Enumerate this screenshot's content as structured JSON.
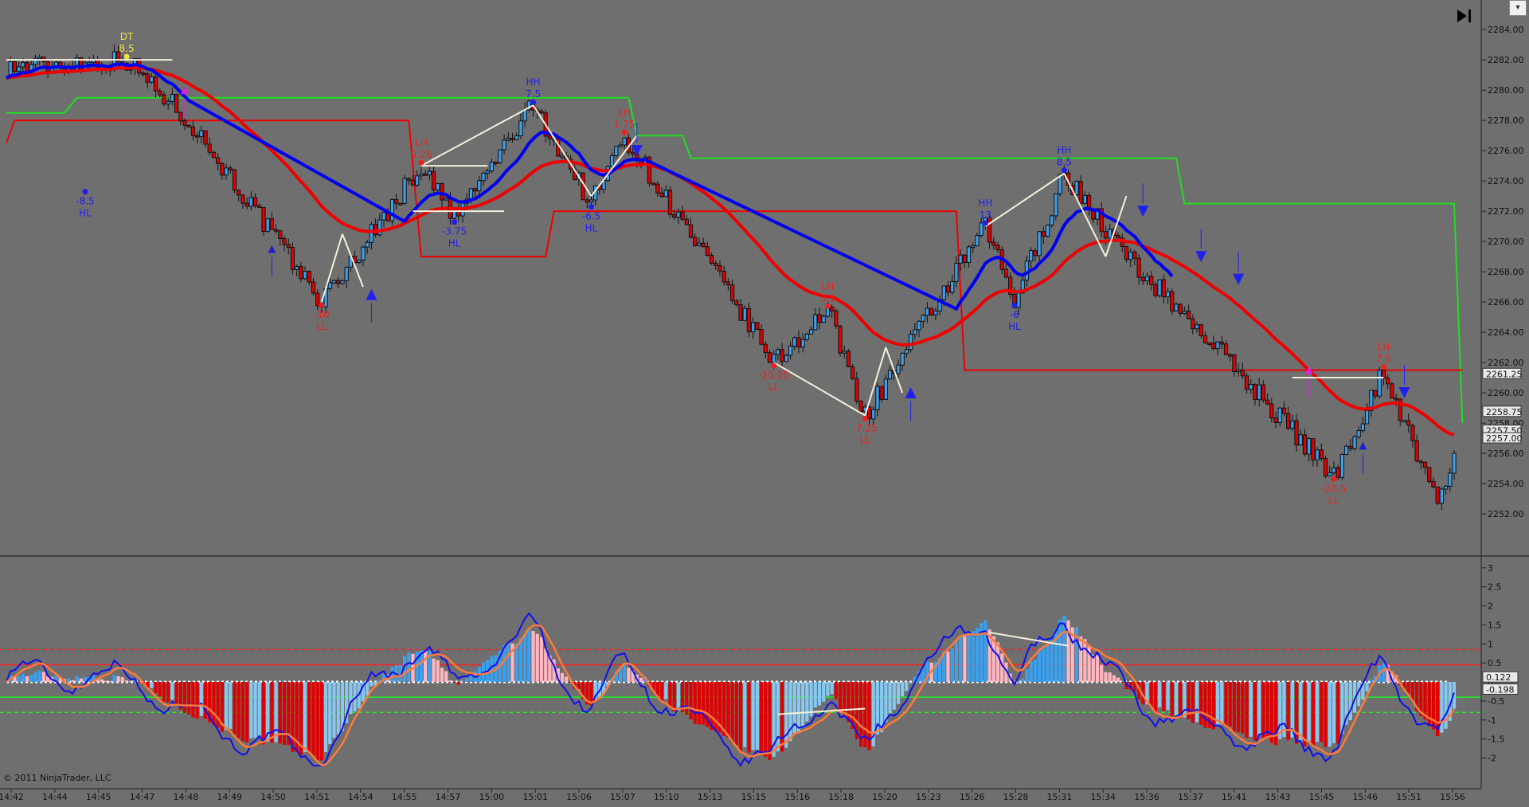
{
  "copyright": "© 2011 NinjaTrader, LLC",
  "scroll_button": "▾",
  "icons": {
    "skip_to_end": "skip-to-end-icon",
    "dropdown": "chevron-down-icon"
  },
  "colors": {
    "background": "#6f6f6f",
    "up_bar": "#3aa0f0",
    "down_bar": "#e00000",
    "ema_fast": "#0000ee",
    "ema_slow": "#ee0000",
    "upper_band": "#22dd22",
    "lower_band": "#ee0000",
    "swing_line": "#f5f0dc",
    "hist_pos_strong": "#3aa0f0",
    "hist_pos_weak": "#ffb6c1",
    "hist_neg_strong": "#e00000",
    "hist_neg_weak": "#87c8f0"
  },
  "chart_data": [
    {
      "type": "candlestick",
      "panel": "price",
      "y_ticks": [
        "2284.00",
        "2282.00",
        "2280.00",
        "2278.00",
        "2276.00",
        "2274.00",
        "2272.00",
        "2270.00",
        "2268.00",
        "2266.00",
        "2264.00",
        "2262.00",
        "2260.00",
        "2258.00",
        "2256.00",
        "2254.00",
        "2252.00"
      ],
      "ylim": [
        2251.0,
        2284.8
      ],
      "price_markers": [
        {
          "label": "2261.25",
          "value": 2261.25,
          "color": "#e8e8e8"
        },
        {
          "label": "2258.75",
          "value": 2258.75,
          "color": "#e8e8e8"
        },
        {
          "label": "2257.50",
          "value": 2257.5,
          "color": "#e8e8e8"
        },
        {
          "label": "2257.00",
          "value": 2257.0,
          "color": "#e8e8e8"
        }
      ],
      "annotations": [
        {
          "lines": [
            "DT",
            "8.5"
          ],
          "bar": 29,
          "price": 2282.0,
          "pos": "above",
          "color": "#f0e040"
        },
        {
          "lines": [
            "-8.5",
            "HL"
          ],
          "bar": 19,
          "price": 2273.5,
          "pos": "below",
          "color": "#2020ee"
        },
        {
          "lines": [
            "-10",
            "LL"
          ],
          "bar": 76,
          "price": 2266.0,
          "pos": "below",
          "color": "#ee2020"
        },
        {
          "lines": [
            "LH",
            "9.25"
          ],
          "bar": 100,
          "price": 2275.0,
          "pos": "above",
          "color": "#ee2020"
        },
        {
          "lines": [
            "-3.75",
            "HL"
          ],
          "bar": 108,
          "price": 2271.5,
          "pos": "below",
          "color": "#2020ee"
        },
        {
          "lines": [
            "HH",
            "7.5"
          ],
          "bar": 127,
          "price": 2279.0,
          "pos": "above",
          "color": "#2020ee"
        },
        {
          "lines": [
            "-6.5",
            "HL"
          ],
          "bar": 141,
          "price": 2272.5,
          "pos": "below",
          "color": "#2020ee"
        },
        {
          "lines": [
            "LH",
            "1.75"
          ],
          "bar": 149,
          "price": 2277.0,
          "pos": "above",
          "color": "#ee2020"
        },
        {
          "lines": [
            "LH",
            "3.5"
          ],
          "bar": 198,
          "price": 2265.5,
          "pos": "above",
          "color": "#ee2020"
        },
        {
          "lines": [
            "-15.25",
            "LL"
          ],
          "bar": 185,
          "price": 2262.0,
          "pos": "below",
          "color": "#ee2020"
        },
        {
          "lines": [
            "-7.25",
            "LL"
          ],
          "bar": 207,
          "price": 2258.5,
          "pos": "below",
          "color": "#ee2020"
        },
        {
          "lines": [
            "HH",
            "13"
          ],
          "bar": 236,
          "price": 2271.0,
          "pos": "above",
          "color": "#2020ee"
        },
        {
          "lines": [
            "-6",
            "HL"
          ],
          "bar": 243,
          "price": 2266.0,
          "pos": "below",
          "color": "#2020ee"
        },
        {
          "lines": [
            "HH",
            "8.5"
          ],
          "bar": 255,
          "price": 2274.5,
          "pos": "above",
          "color": "#2020ee"
        },
        {
          "lines": [
            "-20.5",
            "LL"
          ],
          "bar": 320,
          "price": 2254.5,
          "pos": "below",
          "color": "#ee2020"
        },
        {
          "lines": [
            "LH",
            "7.5"
          ],
          "bar": 332,
          "price": 2261.5,
          "pos": "above",
          "color": "#ee2020"
        }
      ],
      "pivot_path": [
        {
          "bar": 0,
          "price": 2281.5
        },
        {
          "bar": 29,
          "price": 2282.0
        },
        {
          "bar": 44,
          "price": 2278.0
        },
        {
          "bar": 76,
          "price": 2266.0
        },
        {
          "bar": 100,
          "price": 2275.0
        },
        {
          "bar": 108,
          "price": 2271.5
        },
        {
          "bar": 127,
          "price": 2279.0
        },
        {
          "bar": 141,
          "price": 2272.5
        },
        {
          "bar": 149,
          "price": 2277.0
        },
        {
          "bar": 185,
          "price": 2262.0
        },
        {
          "bar": 198,
          "price": 2265.5
        },
        {
          "bar": 207,
          "price": 2258.5
        },
        {
          "bar": 236,
          "price": 2271.0
        },
        {
          "bar": 243,
          "price": 2266.0
        },
        {
          "bar": 255,
          "price": 2274.5
        },
        {
          "bar": 270,
          "price": 2269.0
        },
        {
          "bar": 290,
          "price": 2263.5
        },
        {
          "bar": 320,
          "price": 2254.5
        },
        {
          "bar": 332,
          "price": 2261.5
        },
        {
          "bar": 345,
          "price": 2252.5
        },
        {
          "bar": 349,
          "price": 2256.0
        }
      ],
      "swing_lines": [
        {
          "from": [
            0,
            2282.0
          ],
          "to": [
            40,
            2282.0
          ]
        },
        {
          "from": [
            100,
            2275.0
          ],
          "to": [
            127,
            2279.0
          ]
        },
        {
          "from": [
            100,
            2275.0
          ],
          "to": [
            116,
            2275.0
          ]
        },
        {
          "from": [
            98,
            2272.0
          ],
          "to": [
            120,
            2272.0
          ]
        },
        {
          "from": [
            127,
            2279.0
          ],
          "to": [
            141,
            2273.0
          ]
        },
        {
          "from": [
            141,
            2273.0
          ],
          "to": [
            152,
            2277.0
          ]
        },
        {
          "from": [
            76,
            2266.0
          ],
          "to": [
            81,
            2270.5
          ]
        },
        {
          "from": [
            81,
            2270.5
          ],
          "to": [
            86,
            2267.0
          ]
        },
        {
          "from": [
            185,
            2262.0
          ],
          "to": [
            207,
            2258.5
          ]
        },
        {
          "from": [
            207,
            2258.5
          ],
          "to": [
            212,
            2263.0
          ]
        },
        {
          "from": [
            212,
            2263.0
          ],
          "to": [
            216,
            2260.0
          ]
        },
        {
          "from": [
            236,
            2271.0
          ],
          "to": [
            255,
            2274.5
          ]
        },
        {
          "from": [
            255,
            2274.5
          ],
          "to": [
            265,
            2269.0
          ]
        },
        {
          "from": [
            265,
            2269.0
          ],
          "to": [
            270,
            2273.0
          ]
        },
        {
          "from": [
            310,
            2261.0
          ],
          "to": [
            332,
            2261.0
          ]
        }
      ],
      "arrows": [
        {
          "bar": 64,
          "price": 2269.5,
          "dir": "up",
          "color": "#2020cc",
          "small": true
        },
        {
          "bar": 88,
          "price": 2266.5,
          "dir": "up",
          "color": "#2020ee"
        },
        {
          "bar": 152,
          "price": 2276.0,
          "dir": "down",
          "color": "#2020ee"
        },
        {
          "bar": 43,
          "price": 2280.0,
          "dir": "up",
          "color": "#dd22dd",
          "small": true
        },
        {
          "bar": 218,
          "price": 2260.0,
          "dir": "up",
          "color": "#2020ee"
        },
        {
          "bar": 274,
          "price": 2272.0,
          "dir": "down",
          "color": "#2020ee"
        },
        {
          "bar": 288,
          "price": 2269.0,
          "dir": "down",
          "color": "#2020ee"
        },
        {
          "bar": 297,
          "price": 2267.5,
          "dir": "down",
          "color": "#2020ee"
        },
        {
          "bar": 314,
          "price": 2261.5,
          "dir": "up",
          "color": "#dd22dd",
          "small": true
        },
        {
          "bar": 327,
          "price": 2256.5,
          "dir": "up",
          "color": "#2020cc",
          "small": true
        },
        {
          "bar": 337,
          "price": 2260.0,
          "dir": "down",
          "color": "#2020ee"
        }
      ],
      "upper_band": [
        [
          0,
          2278.5
        ],
        [
          14,
          2278.5
        ],
        [
          17,
          2279.5
        ],
        [
          150,
          2279.5
        ],
        [
          152,
          2277.0
        ],
        [
          163,
          2277.0
        ],
        [
          165,
          2275.5
        ],
        [
          282,
          2275.5
        ],
        [
          284,
          2272.5
        ],
        [
          349,
          2272.5
        ],
        [
          351,
          2258.0
        ]
      ],
      "lower_band": [
        [
          0,
          2276.5
        ],
        [
          2,
          2278.0
        ],
        [
          97,
          2278.0
        ],
        [
          100,
          2269.0
        ],
        [
          130,
          2269.0
        ],
        [
          132,
          2272.0
        ],
        [
          229,
          2272.0
        ],
        [
          231,
          2261.5
        ],
        [
          351,
          2261.5
        ]
      ],
      "time_labels": [
        "14:42",
        "14:44",
        "14:45",
        "14:47",
        "14:48",
        "14:49",
        "14:50",
        "14:51",
        "14:54",
        "14:55",
        "14:57",
        "15:00",
        "15:01",
        "15:06",
        "15:07",
        "15:10",
        "15:13",
        "15:15",
        "15:16",
        "15:18",
        "15:20",
        "15:23",
        "15:26",
        "15:28",
        "15:31",
        "15:34",
        "15:36",
        "15:37",
        "15:41",
        "15:43",
        "15:45",
        "15:46",
        "15:51",
        "15:56"
      ]
    },
    {
      "type": "histogram+lines",
      "panel": "oscillator",
      "y_ticks": [
        "3",
        "2.5",
        "2",
        "1.5",
        "1",
        "0.5",
        "0",
        "-0.5",
        "-1",
        "-1.5",
        "-2"
      ],
      "ylim": [
        -2.45,
        3.1
      ],
      "value_markers": [
        {
          "label": "0.122",
          "value": 0.122
        },
        {
          "label": "-0.198",
          "value": -0.198
        }
      ],
      "levels": [
        {
          "value": 0.85,
          "color": "#ff2020",
          "dashed": true
        },
        {
          "value": 0.45,
          "color": "#ff2020",
          "dashed": false
        },
        {
          "value": -0.4,
          "color": "#22ee22",
          "dashed": false
        },
        {
          "value": -0.8,
          "color": "#22ee22",
          "dashed": true
        }
      ],
      "divergence_lines": [
        {
          "from": [
            237,
            1.3
          ],
          "to": [
            256,
            0.95
          ]
        },
        {
          "from": [
            186,
            -0.85
          ],
          "to": [
            207,
            -0.7
          ]
        }
      ]
    }
  ]
}
